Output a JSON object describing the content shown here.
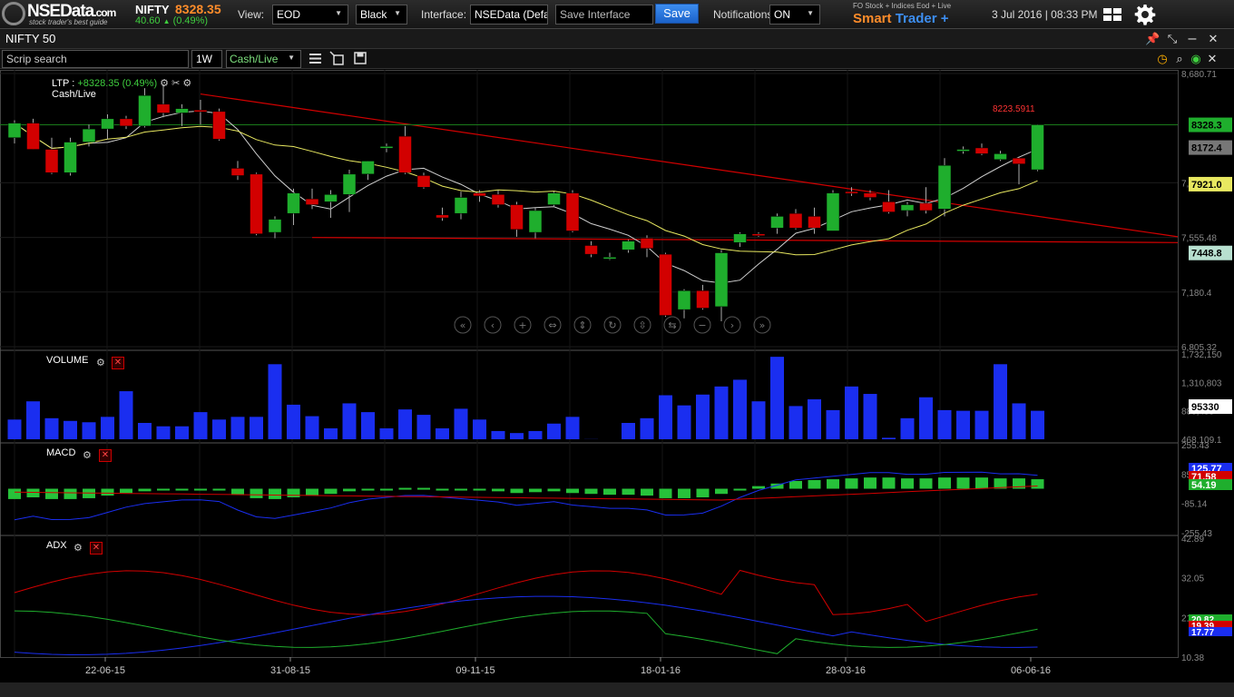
{
  "header": {
    "logo_text": "NSEData",
    "logo_suffix": ".com",
    "logo_tagline": "stock trader's best guide",
    "symbol": "NIFTY",
    "price": "8328.35",
    "change": "40.60",
    "change_pct": "(0.49%)",
    "view_label": "View:",
    "view_value": "EOD",
    "theme_value": "Black",
    "interface_label": "Interface:",
    "interface_value": "NSEData (Defa",
    "save_placeholder": "Save Interface",
    "save_label": "Save",
    "notifications_label": "Notifications:",
    "notifications_value": "ON",
    "promo_top": "FO Stock + Indices Eod + Live",
    "promo_main_1": "Smart",
    "promo_main_2": "Trader +",
    "datetime": "3 Jul 2016 | 08:33 PM"
  },
  "window": {
    "title": "NIFTY 50"
  },
  "toolbar": {
    "search_placeholder": "Scrip search",
    "interval": "1W",
    "mode": "Cash/Live"
  },
  "legend": {
    "ltp_label": "LTP :",
    "ltp_value": "+8328.35 (0.49%)",
    "mode": "Cash/Live",
    "volume": "VOLUME",
    "macd": "MACD",
    "adx": "ADX"
  },
  "colors": {
    "up": "#1fae2d",
    "down": "#d20000",
    "volume": "#1a2ef0",
    "accent": "#3d8ef0",
    "price": "#ff8c2a",
    "change": "#3fcf3f"
  },
  "chart_data": {
    "type": "candlestick",
    "x_ticks": [
      "22-06-15",
      "31-08-15",
      "09-11-15",
      "18-01-16",
      "28-03-16",
      "06-06-16"
    ],
    "price_axis": {
      "range": [
        6805.32,
        8680.71
      ],
      "ticks": [
        "8,680.71",
        "7,930.55",
        "7,555.48",
        "7,180.4",
        "6,805.32"
      ],
      "labels": [
        {
          "text": "8328.3",
          "value": 8328.35,
          "color": "#1fae2d"
        },
        {
          "text": "8172.4",
          "value": 8172.4,
          "color": "#777777"
        },
        {
          "text": "7921.0",
          "value": 7921,
          "color": "#e8e860"
        },
        {
          "text": "7448.8",
          "value": 7448.8,
          "color": "#b8e0d0"
        }
      ],
      "annotation": "8223.5911"
    },
    "candles": [
      [
        8240,
        8360,
        8200,
        8340
      ],
      [
        8340,
        8370,
        8160,
        8160
      ],
      [
        8160,
        8240,
        7990,
        8000
      ],
      [
        8000,
        8240,
        7980,
        8210
      ],
      [
        8210,
        8330,
        8180,
        8300
      ],
      [
        8300,
        8400,
        8230,
        8370
      ],
      [
        8370,
        8390,
        8300,
        8320
      ],
      [
        8320,
        8580,
        8310,
        8530
      ],
      [
        8470,
        8600,
        8380,
        8410
      ],
      [
        8410,
        8470,
        8320,
        8440
      ],
      [
        8430,
        8500,
        8330,
        8420
      ],
      [
        8420,
        8440,
        8220,
        8230
      ],
      [
        8030,
        8080,
        7950,
        7980
      ],
      [
        7990,
        8000,
        7570,
        7580
      ],
      [
        7590,
        7700,
        7550,
        7680
      ],
      [
        7720,
        7890,
        7640,
        7860
      ],
      [
        7820,
        7890,
        7750,
        7780
      ],
      [
        7800,
        7880,
        7690,
        7850
      ],
      [
        7850,
        8020,
        7730,
        7990
      ],
      [
        7990,
        8080,
        7950,
        8080
      ],
      [
        8170,
        8200,
        8140,
        8180
      ],
      [
        8250,
        8320,
        7990,
        8000
      ],
      [
        7980,
        8000,
        7890,
        7900
      ],
      [
        7710,
        7760,
        7670,
        7690
      ],
      [
        7720,
        7870,
        7680,
        7830
      ],
      [
        7860,
        7880,
        7800,
        7840
      ],
      [
        7850,
        7880,
        7760,
        7780
      ],
      [
        7780,
        7800,
        7560,
        7610
      ],
      [
        7590,
        7760,
        7550,
        7740
      ],
      [
        7780,
        7870,
        7770,
        7860
      ],
      [
        7860,
        7880,
        7590,
        7600
      ],
      [
        7500,
        7530,
        7420,
        7440
      ],
      [
        7420,
        7450,
        7400,
        7420
      ],
      [
        7470,
        7540,
        7450,
        7530
      ],
      [
        7550,
        7570,
        7420,
        7480
      ],
      [
        7440,
        7450,
        7010,
        7020
      ],
      [
        7060,
        7200,
        7000,
        7190
      ],
      [
        7190,
        7230,
        7060,
        7070
      ],
      [
        7080,
        7470,
        6980,
        7450
      ],
      [
        7520,
        7590,
        7490,
        7580
      ],
      [
        7580,
        7590,
        7560,
        7570
      ],
      [
        7620,
        7720,
        7580,
        7700
      ],
      [
        7720,
        7750,
        7610,
        7620
      ],
      [
        7700,
        7760,
        7580,
        7620
      ],
      [
        7600,
        7880,
        7600,
        7860
      ],
      [
        7870,
        7900,
        7840,
        7860
      ],
      [
        7860,
        7880,
        7810,
        7830
      ],
      [
        7800,
        7880,
        7720,
        7730
      ],
      [
        7740,
        7800,
        7700,
        7780
      ],
      [
        7790,
        7900,
        7720,
        7740
      ],
      [
        7750,
        8100,
        7700,
        8050
      ],
      [
        8150,
        8180,
        8130,
        8160
      ],
      [
        8170,
        8200,
        8120,
        8130
      ],
      [
        8090,
        8150,
        8080,
        8130
      ],
      [
        8100,
        8110,
        7920,
        8060
      ],
      [
        8020,
        8330,
        8010,
        8328
      ]
    ],
    "volume": {
      "ticks": [
        "1,732,150",
        "1,310,803",
        "889,455",
        "468,109.1"
      ],
      "range": [
        468109.1,
        1732150
      ],
      "label": "95330",
      "values": [
        760,
        1030,
        780,
        740,
        720,
        800,
        1180,
        710,
        660,
        660,
        870,
        760,
        800,
        800,
        1580,
        980,
        810,
        630,
        1000,
        870,
        630,
        910,
        830,
        630,
        920,
        760,
        590,
        560,
        590,
        700,
        800,
        470,
        400,
        710,
        780,
        1120,
        970,
        1130,
        1250,
        1350,
        1030,
        1690,
        960,
        1060,
        900,
        1250,
        1140,
        490,
        780,
        1090,
        900,
        890,
        890,
        1580,
        1000,
        890,
        890,
        970
      ]
    },
    "macd": {
      "ticks": [
        "255.43",
        "85.14",
        "-85.14",
        "-255.43"
      ],
      "range": [
        -255.43,
        255.43
      ],
      "labels": [
        {
          "text": "125.77",
          "color": "#1a2ef0"
        },
        {
          "text": "71.58",
          "color": "#d20000"
        },
        {
          "text": "54.19",
          "color": "#1fae2d"
        }
      ],
      "hist": [
        -60,
        -50,
        -60,
        -60,
        -55,
        -40,
        -25,
        -15,
        -10,
        -5,
        -5,
        -10,
        -35,
        -55,
        -60,
        -50,
        -40,
        -30,
        -15,
        -5,
        0,
        5,
        5,
        0,
        -5,
        -10,
        -15,
        -25,
        -20,
        -15,
        -25,
        -30,
        -35,
        -35,
        -40,
        -55,
        -55,
        -50,
        -30,
        -5,
        15,
        30,
        45,
        50,
        55,
        60,
        65,
        65,
        60,
        60,
        65,
        65,
        65,
        60,
        60,
        55
      ]
    },
    "adx": {
      "ticks": [
        "42.89",
        "32.05",
        "21.22",
        "10.38"
      ],
      "range": [
        10.38,
        42.89
      ],
      "labels": [
        {
          "text": "20.82",
          "color": "#1fae2d"
        },
        {
          "text": "19.39",
          "color": "#d20000"
        },
        {
          "text": "17.77",
          "color": "#1a2ef0"
        }
      ]
    }
  }
}
